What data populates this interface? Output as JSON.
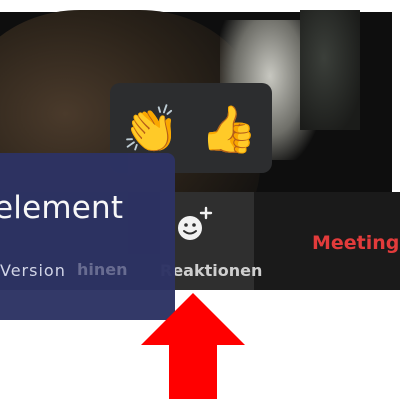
{
  "toolbar": {
    "reactions_label": "Reaktionen",
    "meeting_label": "Meeting",
    "hidden_left_label": "hinen"
  },
  "reaction_popup": {
    "emojis": [
      {
        "name": "clapping-hands",
        "glyph": "👏"
      },
      {
        "name": "thumbs-up",
        "glyph": "👍"
      }
    ]
  },
  "logo": {
    "title": "element",
    "subtitle": "Version"
  },
  "colors": {
    "arrow": "#ff0000",
    "logo_bg": "#2d3364",
    "meeting_text": "#e23b3b"
  },
  "icons": {
    "reaction_add": "smiley-plus-icon",
    "arrow": "up-arrow-icon"
  }
}
